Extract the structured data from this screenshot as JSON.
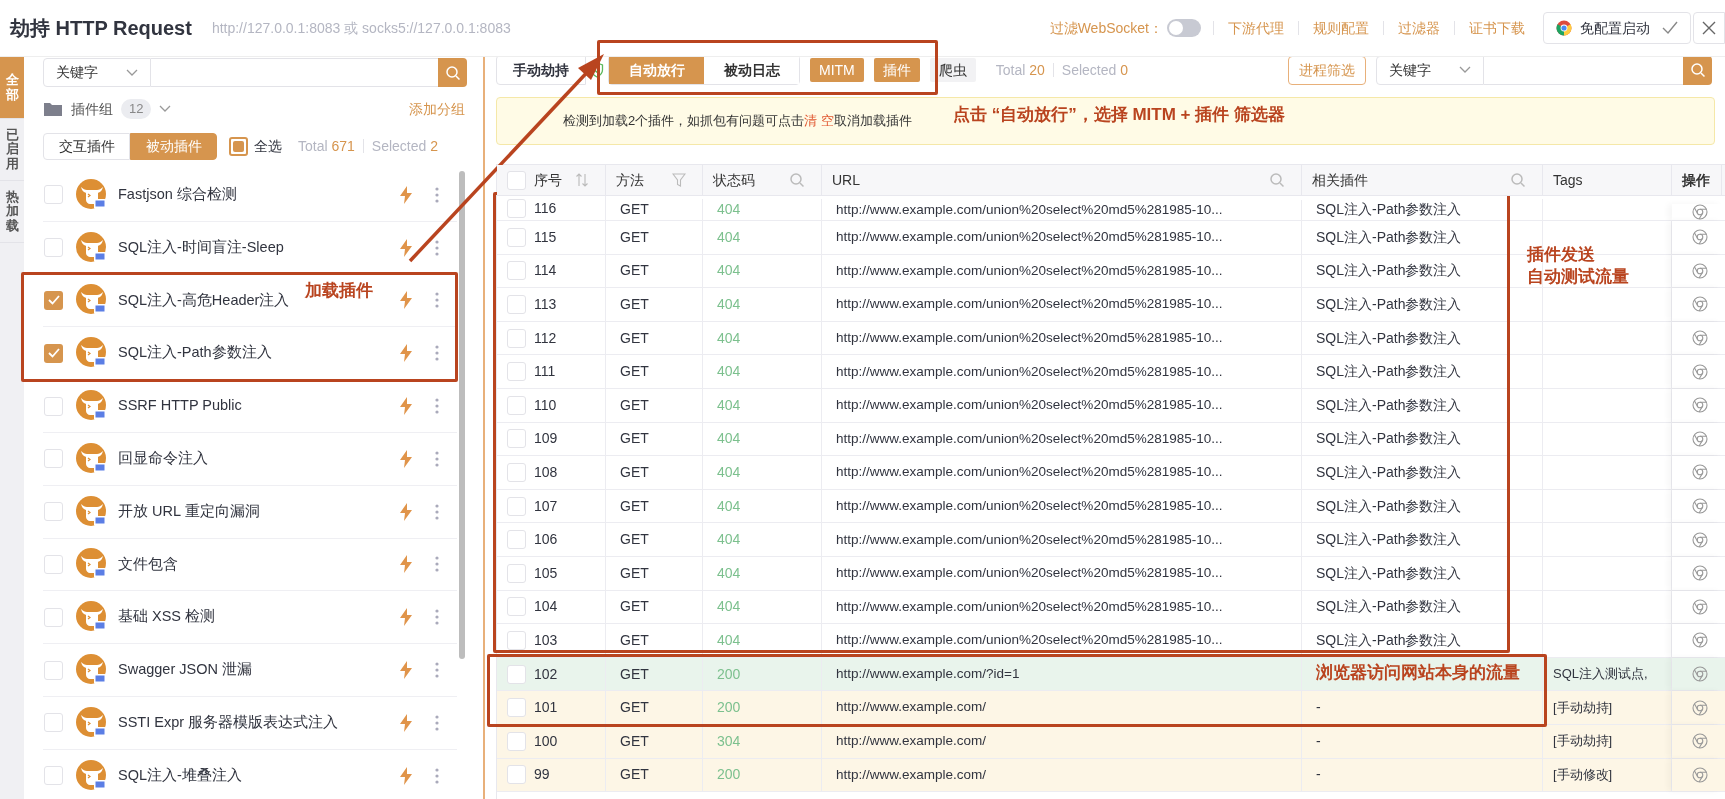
{
  "header": {
    "title": "劫持 HTTP Request",
    "address": "http://127.0.0.1:8083 或 socks5://127.0.0.1:8083",
    "websocket_filter": {
      "label": "过滤WebSocket：",
      "on": false
    },
    "links": [
      "下游代理",
      "规则配置",
      "过滤器",
      "证书下载"
    ],
    "launch_button": "免配置启动"
  },
  "side_tabs": [
    {
      "label": "全部",
      "selected": true
    },
    {
      "label": "已启用",
      "selected": false
    },
    {
      "label": "热加载",
      "selected": false
    }
  ],
  "plugin_panel": {
    "search": {
      "mode": "关键字"
    },
    "group": {
      "label": "插件组",
      "count": "12",
      "add": "添加分组"
    },
    "types": [
      {
        "label": "交互插件",
        "selected": false
      },
      {
        "label": "被动插件",
        "selected": true
      }
    ],
    "select_all": {
      "label": "全选",
      "indeterminate": true
    },
    "total_label": "Total",
    "total": "671",
    "selected_label": "Selected",
    "selected": "2",
    "plugins": [
      {
        "name": "Fastjson 综合检测",
        "checked": false
      },
      {
        "name": "SQL注入-时间盲注-Sleep",
        "checked": false
      },
      {
        "name": "SQL注入-高危Header注入",
        "checked": true
      },
      {
        "name": "SQL注入-Path参数注入",
        "checked": true
      },
      {
        "name": "SSRF HTTP Public",
        "checked": false
      },
      {
        "name": "回显命令注入",
        "checked": false
      },
      {
        "name": "开放 URL 重定向漏洞",
        "checked": false
      },
      {
        "name": "文件包含",
        "checked": false
      },
      {
        "name": "基础 XSS 检测",
        "checked": false
      },
      {
        "name": "Swagger JSON 泄漏",
        "checked": false
      },
      {
        "name": "SSTI Expr 服务器模版表达式注入",
        "checked": false
      },
      {
        "name": "SQL注入-堆叠注入",
        "checked": false
      }
    ]
  },
  "traffic": {
    "hijack_button": "手动劫持",
    "modes": [
      {
        "label": "自动放行",
        "selected": true
      },
      {
        "label": "被动日志",
        "selected": false
      }
    ],
    "filters": [
      {
        "label": "MITM",
        "selected": true
      },
      {
        "label": "插件",
        "selected": true
      },
      {
        "label": "爬虫",
        "selected": false
      }
    ],
    "total_label": "Total",
    "total": "20",
    "selected_label": "Selected",
    "selected": "0",
    "process_filter": "进程筛选",
    "search": {
      "mode": "关键字"
    },
    "notice": {
      "before": "检测到加载2个插件，如抓包有问题可点击",
      "link": "清 空",
      "after": "取消加载插件"
    },
    "table": {
      "select_all_checked": false,
      "columns": [
        "序号",
        "方法",
        "状态码",
        "URL",
        "相关插件",
        "Tags",
        "操作"
      ],
      "rows": [
        {
          "id": "116",
          "method": "GET",
          "status": "404",
          "url": "http://www.example.com/union%20select%20md5%281985-10...",
          "plugin": "SQL注入-Path参数注入",
          "color": "#ffffff"
        },
        {
          "id": "115",
          "method": "GET",
          "status": "404",
          "url": "http://www.example.com/union%20select%20md5%281985-10...",
          "plugin": "SQL注入-Path参数注入",
          "color": "#ffffff"
        },
        {
          "id": "114",
          "method": "GET",
          "status": "404",
          "url": "http://www.example.com/union%20select%20md5%281985-10...",
          "plugin": "SQL注入-Path参数注入",
          "color": "#ffffff"
        },
        {
          "id": "113",
          "method": "GET",
          "status": "404",
          "url": "http://www.example.com/union%20select%20md5%281985-10...",
          "plugin": "SQL注入-Path参数注入",
          "color": "#ffffff"
        },
        {
          "id": "112",
          "method": "GET",
          "status": "404",
          "url": "http://www.example.com/union%20select%20md5%281985-10...",
          "plugin": "SQL注入-Path参数注入",
          "color": "#ffffff"
        },
        {
          "id": "111",
          "method": "GET",
          "status": "404",
          "url": "http://www.example.com/union%20select%20md5%281985-10...",
          "plugin": "SQL注入-Path参数注入",
          "color": "#ffffff"
        },
        {
          "id": "110",
          "method": "GET",
          "status": "404",
          "url": "http://www.example.com/union%20select%20md5%281985-10...",
          "plugin": "SQL注入-Path参数注入",
          "color": "#ffffff"
        },
        {
          "id": "109",
          "method": "GET",
          "status": "404",
          "url": "http://www.example.com/union%20select%20md5%281985-10...",
          "plugin": "SQL注入-Path参数注入",
          "color": "#ffffff"
        },
        {
          "id": "108",
          "method": "GET",
          "status": "404",
          "url": "http://www.example.com/union%20select%20md5%281985-10...",
          "plugin": "SQL注入-Path参数注入",
          "color": "#ffffff"
        },
        {
          "id": "107",
          "method": "GET",
          "status": "404",
          "url": "http://www.example.com/union%20select%20md5%281985-10...",
          "plugin": "SQL注入-Path参数注入",
          "color": "#ffffff"
        },
        {
          "id": "106",
          "method": "GET",
          "status": "404",
          "url": "http://www.example.com/union%20select%20md5%281985-10...",
          "plugin": "SQL注入-Path参数注入",
          "color": "#ffffff"
        },
        {
          "id": "105",
          "method": "GET",
          "status": "404",
          "url": "http://www.example.com/union%20select%20md5%281985-10...",
          "plugin": "SQL注入-Path参数注入",
          "color": "#ffffff"
        },
        {
          "id": "104",
          "method": "GET",
          "status": "404",
          "url": "http://www.example.com/union%20select%20md5%281985-10...",
          "plugin": "SQL注入-Path参数注入",
          "color": "#ffffff"
        },
        {
          "id": "103",
          "method": "GET",
          "status": "404",
          "url": "http://www.example.com/union%20select%20md5%281985-10...",
          "plugin": "SQL注入-Path参数注入",
          "color": "#ffffff"
        },
        {
          "id": "102",
          "method": "GET",
          "status": "200",
          "url": "http://www.example.com/?id=1",
          "tags": "SQL注入测试点,",
          "color": "#e9f4ec"
        },
        {
          "id": "101",
          "method": "GET",
          "status": "200",
          "url": "http://www.example.com/",
          "plugin": "-",
          "tags": "[手动劫持]",
          "color": "#fdf6e6"
        },
        {
          "id": "100",
          "method": "GET",
          "status": "304",
          "url": "http://www.example.com/",
          "plugin": "-",
          "tags": "[手动劫持]",
          "color": "#fdf6e6"
        },
        {
          "id": "99",
          "method": "GET",
          "status": "200",
          "url": "http://www.example.com/",
          "plugin": "-",
          "tags": "[手动修改]",
          "color": "#fdf6e6"
        }
      ]
    }
  },
  "annotations": [
    {
      "kind": "mode-note",
      "text": "点击 “自动放行”，选择 MITM + 插件 筛选器"
    },
    {
      "kind": "plugin-note",
      "text": "加载插件"
    },
    {
      "kind": "table-note",
      "text": "插件发送"
    },
    {
      "kind": "table-note-2",
      "text": "自动测试流量"
    },
    {
      "kind": "browser-note",
      "text": "浏览器访问网站本身的流量"
    }
  ]
}
